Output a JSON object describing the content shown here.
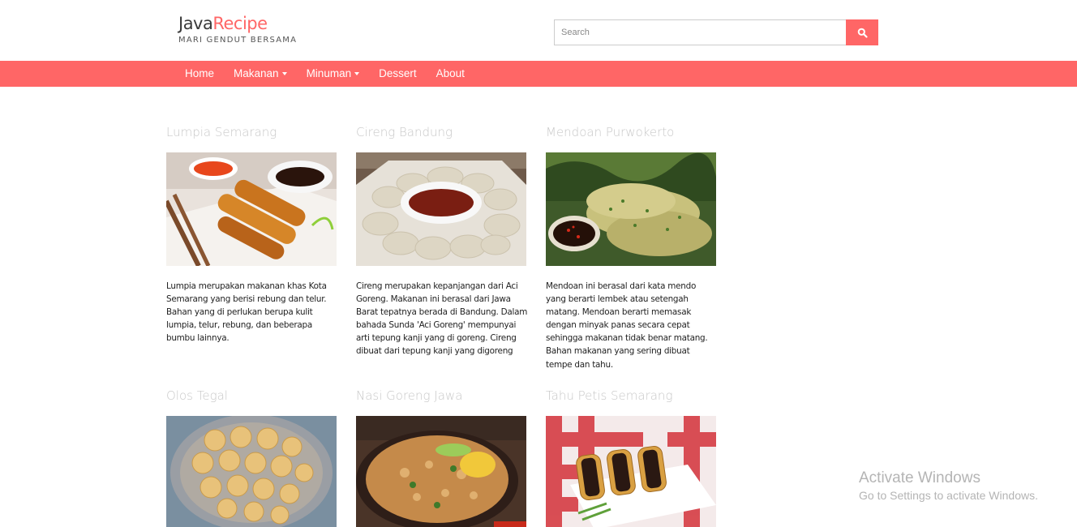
{
  "brand": {
    "part1": "Java",
    "part2": "Recipe",
    "tagline": "MARI GENDUT BERSAMA"
  },
  "search": {
    "placeholder": "Search",
    "value": "",
    "button_icon": "search-icon"
  },
  "colors": {
    "accent": "#ff6666",
    "title_faded": "#c8c8c8"
  },
  "nav": {
    "items": [
      {
        "label": "Home",
        "dropdown": false
      },
      {
        "label": "Makanan",
        "dropdown": true
      },
      {
        "label": "Minuman",
        "dropdown": true
      },
      {
        "label": "Dessert",
        "dropdown": false
      },
      {
        "label": "About",
        "dropdown": false
      }
    ]
  },
  "recipes": [
    {
      "title": "Lumpia Semarang",
      "image": "lumpia-spring-rolls-photo",
      "description": "Lumpia merupakan makanan khas Kota Semarang yang berisi rebung dan telur. Bahan yang di perlukan berupa kulit lumpia, telur, rebung, dan beberapa bumbu lainnya."
    },
    {
      "title": "Cireng Bandung",
      "image": "cireng-fried-dough-photo",
      "description": "Cireng merupakan kepanjangan dari Aci Goreng. Makanan ini berasal dari Jawa Barat tepatnya berada di Bandung. Dalam bahada Sunda 'Aci Goreng' mempunyai arti tepung kanji yang di goreng. Cireng dibuat dari tepung kanji yang digoreng"
    },
    {
      "title": "Mendoan Purwokerto",
      "image": "mendoan-fried-tempeh-photo",
      "description": "Mendoan ini berasal dari kata mendo yang berarti lembek atau setengah matang. Mendoan berarti memasak dengan minyak panas secara cepat sehingga makanan tidak benar matang. Bahan makanan yang sering dibuat tempe dan tahu."
    },
    {
      "title": "Olos Tegal",
      "image": "olos-fried-balls-photo",
      "description": ""
    },
    {
      "title": "Nasi Goreng Jawa",
      "image": "nasi-goreng-photo",
      "description": ""
    },
    {
      "title": "Tahu Petis Semarang",
      "image": "tahu-petis-photo",
      "description": ""
    }
  ],
  "watermark": {
    "title": "Activate Windows",
    "subtitle": "Go to Settings to activate Windows."
  }
}
